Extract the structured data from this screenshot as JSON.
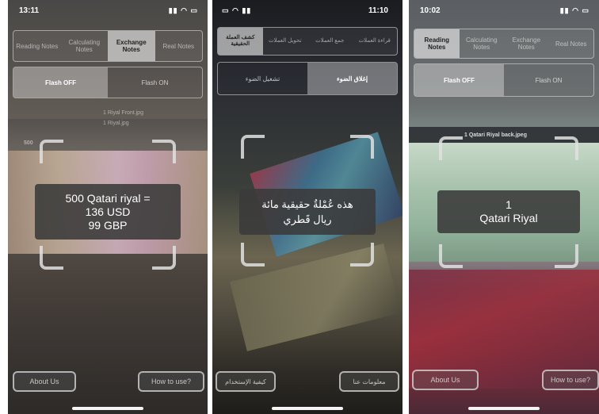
{
  "screens": [
    {
      "status_time": "13:11",
      "tabs": [
        "Reading Notes",
        "Calculating Notes",
        "Exchange Notes",
        "Real Notes"
      ],
      "selected_tab": 2,
      "flash": [
        "Flash OFF",
        "Flash ON"
      ],
      "flash_selected": 0,
      "result": {
        "line1": "500 Qatari riyal =",
        "line2": "136 USD",
        "line3": "99 GBP"
      },
      "buttons": {
        "left": "About Us",
        "right": "How to use?"
      },
      "background_text": [
        "1 Riyal Front.jpg",
        "1 Riyal.jpg",
        "500"
      ]
    },
    {
      "status_time": "11:10",
      "tabs": [
        "كشف العملة الحقيقية",
        "تحويل العملات",
        "جمع العملات",
        "قراءة العملات"
      ],
      "selected_tab": 0,
      "flash": [
        "تشغيل الضوء",
        "إغلاق الضوء"
      ],
      "flash_selected": 1,
      "result": {
        "line1": "هذه عُمْلةٌ حقيقية مائة",
        "line2": "ريال قَطري"
      },
      "buttons": {
        "left": "كيفية الإستخدام",
        "right": "معلومات عنا"
      }
    },
    {
      "status_time": "10:02",
      "tabs": [
        "Reading Notes",
        "Calculating Notes",
        "Exchange Notes",
        "Real Notes"
      ],
      "selected_tab": 0,
      "flash": [
        "Flash OFF",
        "Flash ON"
      ],
      "flash_selected": 0,
      "result": {
        "line1": "1",
        "line2": "Qatari Riyal"
      },
      "buttons": {
        "left": "About Us",
        "right": "How to use?"
      },
      "background_text": [
        "1 Qatari Riyal back.jpeg"
      ]
    }
  ]
}
